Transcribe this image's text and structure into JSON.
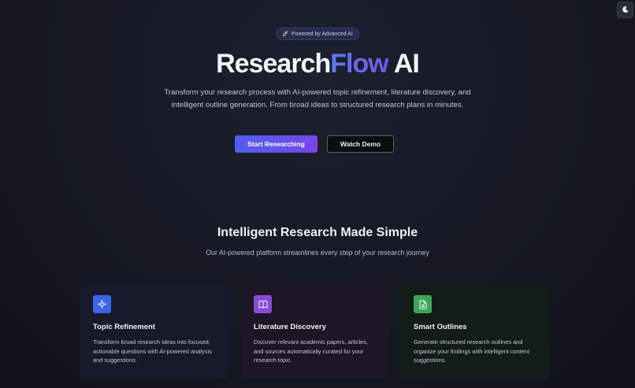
{
  "header": {
    "theme_toggle_icon": "moon-icon"
  },
  "hero": {
    "badge_icon": "🚀",
    "badge_text": "Powered by Advanced AI",
    "title_part1": "Research",
    "title_accent": "Flow",
    "title_part2": " AI",
    "subtitle": "Transform your research process with AI-powered topic refinement, literature discovery, and intelligent outline generation. From broad ideas to structured research plans in minutes.",
    "primary_button": "Start Researching",
    "secondary_button": "Watch Demo"
  },
  "features": {
    "title": "Intelligent Research Made Simple",
    "subtitle": "Our AI-powered platform streamlines every step of your research journey",
    "cards": [
      {
        "icon": "sparkle-icon",
        "title": "Topic Refinement",
        "description": "Transform broad research ideas into focused, actionable questions with AI-powered analysis and suggestions."
      },
      {
        "icon": "book-icon",
        "title": "Literature Discovery",
        "description": "Discover relevant academic papers, articles, and sources automatically curated for your research topic."
      },
      {
        "icon": "document-icon",
        "title": "Smart Outlines",
        "description": "Generate structured research outlines and organize your findings with intelligent content suggestions."
      }
    ]
  },
  "colors": {
    "background": "#141722",
    "accent_start": "#4f5ff0",
    "accent_end": "#7a45e6",
    "card1_icon_bg": "#3b64e6",
    "card2_icon_bg": "#8a4bd6",
    "card3_icon_bg": "#3aa55a"
  }
}
